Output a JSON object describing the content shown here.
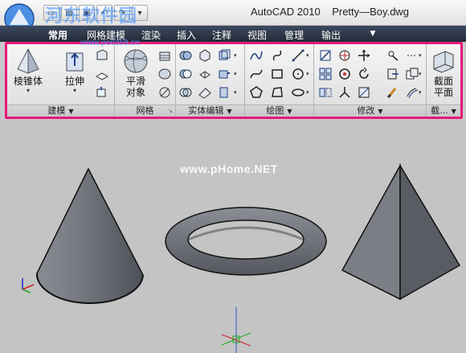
{
  "titlebar": {
    "app_name": "AutoCAD 2010",
    "document": "Pretty—Boy.dwg",
    "watermark": "河东软件园",
    "qat": [
      "new-icon",
      "open-icon",
      "save-icon",
      "undo-icon",
      "redo-icon",
      "dropdown-icon"
    ]
  },
  "tabs": [
    {
      "label": "常用",
      "active": true
    },
    {
      "label": "网格建模",
      "active": false
    },
    {
      "label": "渲染",
      "active": false
    },
    {
      "label": "插入",
      "active": false
    },
    {
      "label": "注释",
      "active": false
    },
    {
      "label": "视图",
      "active": false
    },
    {
      "label": "管理",
      "active": false
    },
    {
      "label": "输出",
      "active": false
    }
  ],
  "url_watermark": "www.pc0359.cn",
  "ribbon": {
    "panels": {
      "modeling": {
        "label": "建模",
        "big_buttons": [
          {
            "label": "棱锥体",
            "icon": "pyramid-icon"
          },
          {
            "label": "拉伸",
            "icon": "extrude-icon"
          }
        ]
      },
      "mesh": {
        "label": "网格",
        "big_buttons": [
          {
            "label_line1": "平滑",
            "label_line2": "对象",
            "icon": "smooth-object-icon"
          }
        ]
      },
      "solid_editing": {
        "label": "实体编辑"
      },
      "draw": {
        "label": "绘图"
      },
      "modify": {
        "label": "修改"
      },
      "section": {
        "label": "截...",
        "big_buttons": [
          {
            "label_line1": "截面",
            "label_line2": "平面",
            "icon": "section-plane-icon"
          }
        ]
      }
    }
  },
  "viewport": {
    "watermark": "www.pHome.NET",
    "objects": [
      "cone",
      "torus",
      "pyramid"
    ]
  },
  "colors": {
    "ribbon_highlight": "#e6197a",
    "tab_bar": "#2a3444",
    "viewport_bg": "#c4c4c4",
    "solid_fill": "#6e7078"
  }
}
